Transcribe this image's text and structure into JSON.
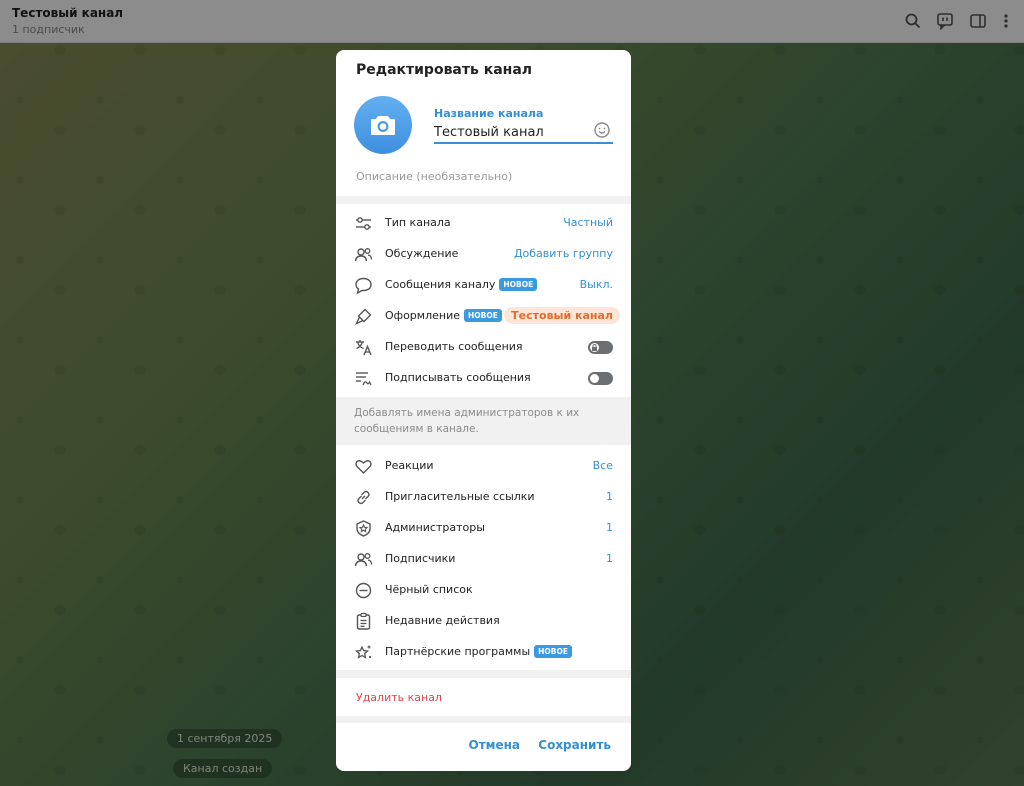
{
  "header": {
    "title": "Тестовый канал",
    "subtitle": "1 подписчик"
  },
  "chat": {
    "date_pill": "1 сентября 2025",
    "created_pill": "Канал создан"
  },
  "dialog": {
    "title": "Редактировать канал",
    "name_label": "Название канала",
    "name_value": "Тестовый канал",
    "description_placeholder": "Описание (необязательно)",
    "settings": {
      "type": {
        "label": "Тип канала",
        "value": "Частный"
      },
      "discussion": {
        "label": "Обсуждение",
        "value": "Добавить группу"
      },
      "messages": {
        "label": "Сообщения каналу",
        "badge": "НОВОЕ",
        "value": "Выкл."
      },
      "appearance": {
        "label": "Оформление",
        "badge": "НОВОЕ",
        "value": "Тестовый канал"
      },
      "translate": {
        "label": "Переводить сообщения"
      },
      "sign": {
        "label": "Подписывать сообщения"
      }
    },
    "sign_note": "Добавлять имена администраторов к их сообщениям в канале.",
    "manage": {
      "reactions": {
        "label": "Реакции",
        "value": "Все"
      },
      "invites": {
        "label": "Пригласительные ссылки",
        "value": "1"
      },
      "admins": {
        "label": "Администраторы",
        "value": "1"
      },
      "subscribers": {
        "label": "Подписчики",
        "value": "1"
      },
      "blacklist": {
        "label": "Чёрный список"
      },
      "recent": {
        "label": "Недавние действия"
      },
      "partners": {
        "label": "Партнёрские программы",
        "badge": "НОВОЕ"
      }
    },
    "delete_label": "Удалить канал",
    "cancel_label": "Отмена",
    "save_label": "Сохранить"
  },
  "colors": {
    "accent": "#3390d0",
    "danger": "#e0464a",
    "badge": "#3a9ae0",
    "appearance_pill_bg": "#fde6d8",
    "appearance_pill_text": "#e06c2c"
  },
  "icons": {
    "topbar": [
      "search-icon",
      "topic-comment-icon",
      "sidebar-toggle-icon",
      "more-vert-icon"
    ],
    "avatar": "camera-icon"
  }
}
